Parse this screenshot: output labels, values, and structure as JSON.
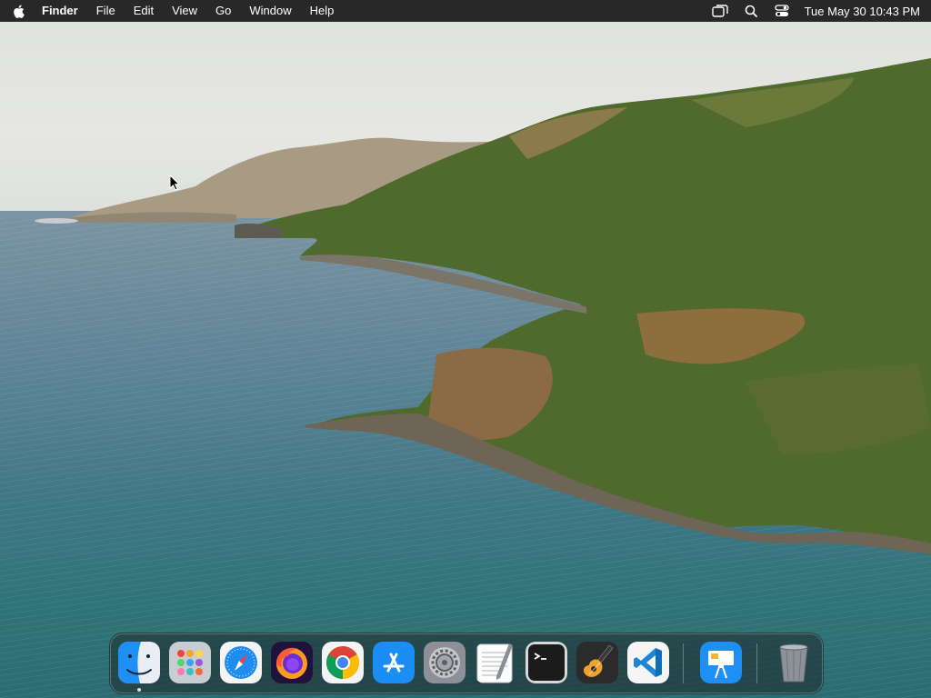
{
  "menubar": {
    "apple_icon": "apple-logo-icon",
    "app_name": "Finder",
    "menus": [
      "File",
      "Edit",
      "View",
      "Go",
      "Window",
      "Help"
    ],
    "status_icons": [
      "screen-mirroring-icon",
      "spotlight-search-icon",
      "control-center-icon"
    ],
    "clock": "Tue May 30  10:43 PM"
  },
  "dock": {
    "apps": [
      {
        "name": "Finder",
        "icon": "finder-icon",
        "running": true
      },
      {
        "name": "Launchpad",
        "icon": "launchpad-icon"
      },
      {
        "name": "Safari",
        "icon": "safari-icon"
      },
      {
        "name": "Firefox",
        "icon": "firefox-icon"
      },
      {
        "name": "Google Chrome",
        "icon": "chrome-icon"
      },
      {
        "name": "App Store",
        "icon": "app-store-icon"
      },
      {
        "name": "System Preferences",
        "icon": "system-preferences-icon"
      },
      {
        "name": "TextEdit",
        "icon": "textedit-icon"
      },
      {
        "name": "Terminal",
        "icon": "terminal-icon"
      },
      {
        "name": "GarageBand",
        "icon": "garageband-icon"
      },
      {
        "name": "Visual Studio Code",
        "icon": "vscode-icon"
      },
      {
        "name": "Keynote",
        "icon": "keynote-icon"
      },
      {
        "name": "Trash",
        "icon": "trash-icon"
      }
    ]
  },
  "colors": {
    "menubar_bg": "#181818",
    "dock_bg": "#1e2628",
    "sea": "#3f7785",
    "sky": "#e2e3de",
    "hills_green": "#4f6a2c"
  }
}
